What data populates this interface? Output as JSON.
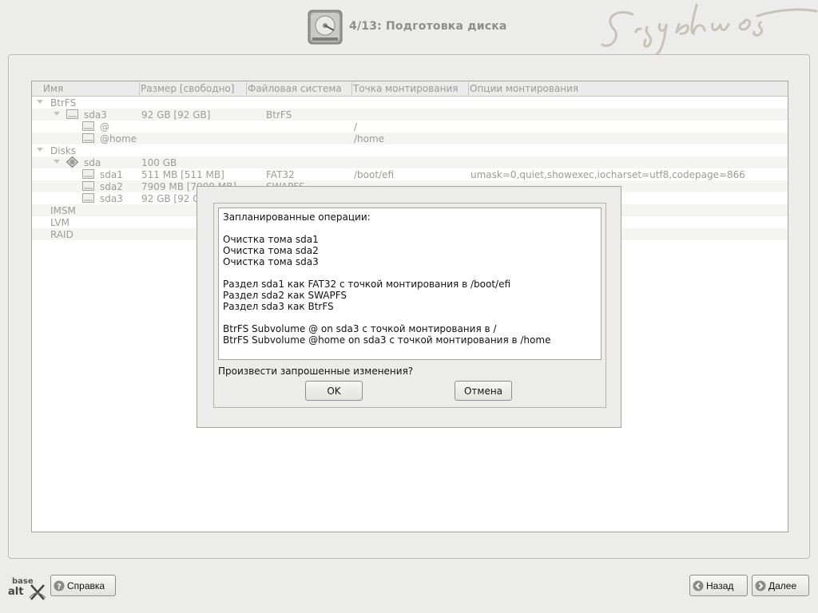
{
  "header": {
    "step_title": "4/13: Подготовка диска",
    "brand": "Sisyphus"
  },
  "table": {
    "columns": [
      "Имя",
      "Размер [свободно]",
      "Файловая система",
      "Точка монтирования",
      "Опции монтирования"
    ],
    "rows": [
      {
        "name": "BtrFS",
        "size": "",
        "fs": "",
        "mount": "",
        "options": ""
      },
      {
        "name": "sda3",
        "size": "92 GB [92 GB]",
        "fs": "BtrFS",
        "mount": "",
        "options": ""
      },
      {
        "name": "@",
        "size": "",
        "fs": "",
        "mount": "/",
        "options": ""
      },
      {
        "name": "@home",
        "size": "",
        "fs": "",
        "mount": "/home",
        "options": ""
      },
      {
        "name": "Disks",
        "size": "",
        "fs": "",
        "mount": "",
        "options": ""
      },
      {
        "name": "sda",
        "size": "100 GB",
        "fs": "",
        "mount": "",
        "options": ""
      },
      {
        "name": "sda1",
        "size": "511 MB [511 MB]",
        "fs": "FAT32",
        "mount": "/boot/efi",
        "options": "umask=0,quiet,showexec,iocharset=utf8,codepage=866"
      },
      {
        "name": "sda2",
        "size": "7909 MB [7909 MB]",
        "fs": "SWAPFS",
        "mount": "",
        "options": ""
      },
      {
        "name": "sda3",
        "size": "92 GB [92 GB]",
        "fs": "",
        "mount": "",
        "options": ""
      },
      {
        "name": "IMSM",
        "size": "",
        "fs": "",
        "mount": "",
        "options": ""
      },
      {
        "name": "LVM",
        "size": "",
        "fs": "",
        "mount": "",
        "options": ""
      },
      {
        "name": "RAID",
        "size": "",
        "fs": "",
        "mount": "",
        "options": ""
      }
    ]
  },
  "dialog": {
    "heading": "Запланированные операции:",
    "clean_ops": [
      "Очистка тома sda1",
      "Очистка тома sda2",
      "Очистка тома sda3"
    ],
    "partition_ops": [
      "Раздел sda1 как FAT32 с точкой монтирования в /boot/efi",
      "Раздел sda2 как SWAPFS",
      "Раздел sda3 как BtrFS"
    ],
    "subvolume_ops": [
      "BtrFS Subvolume @ on sda3 с точкой монтирования в /",
      "BtrFS Subvolume @home on sda3 с точкой монтирования в /home"
    ],
    "question": "Произвести запрошенные изменения?",
    "ok_label": "OK",
    "cancel_label": "Отмена"
  },
  "footer": {
    "logo_top": "base",
    "logo_bottom": "alt",
    "help_label": "Справка",
    "back_label": "Назад",
    "next_label": "Далее"
  },
  "icons": {
    "step": "hard-disk-icon",
    "folder": "folder-icon",
    "disk": "disk-drive-icon",
    "help": "help-circle-icon",
    "back": "arrow-left-icon",
    "next": "arrow-right-icon"
  },
  "colors": {
    "background": "#ececea",
    "muted_text": "#9b9b98",
    "step_title": "#8d8d8a",
    "brand": "#c8c3b8"
  }
}
